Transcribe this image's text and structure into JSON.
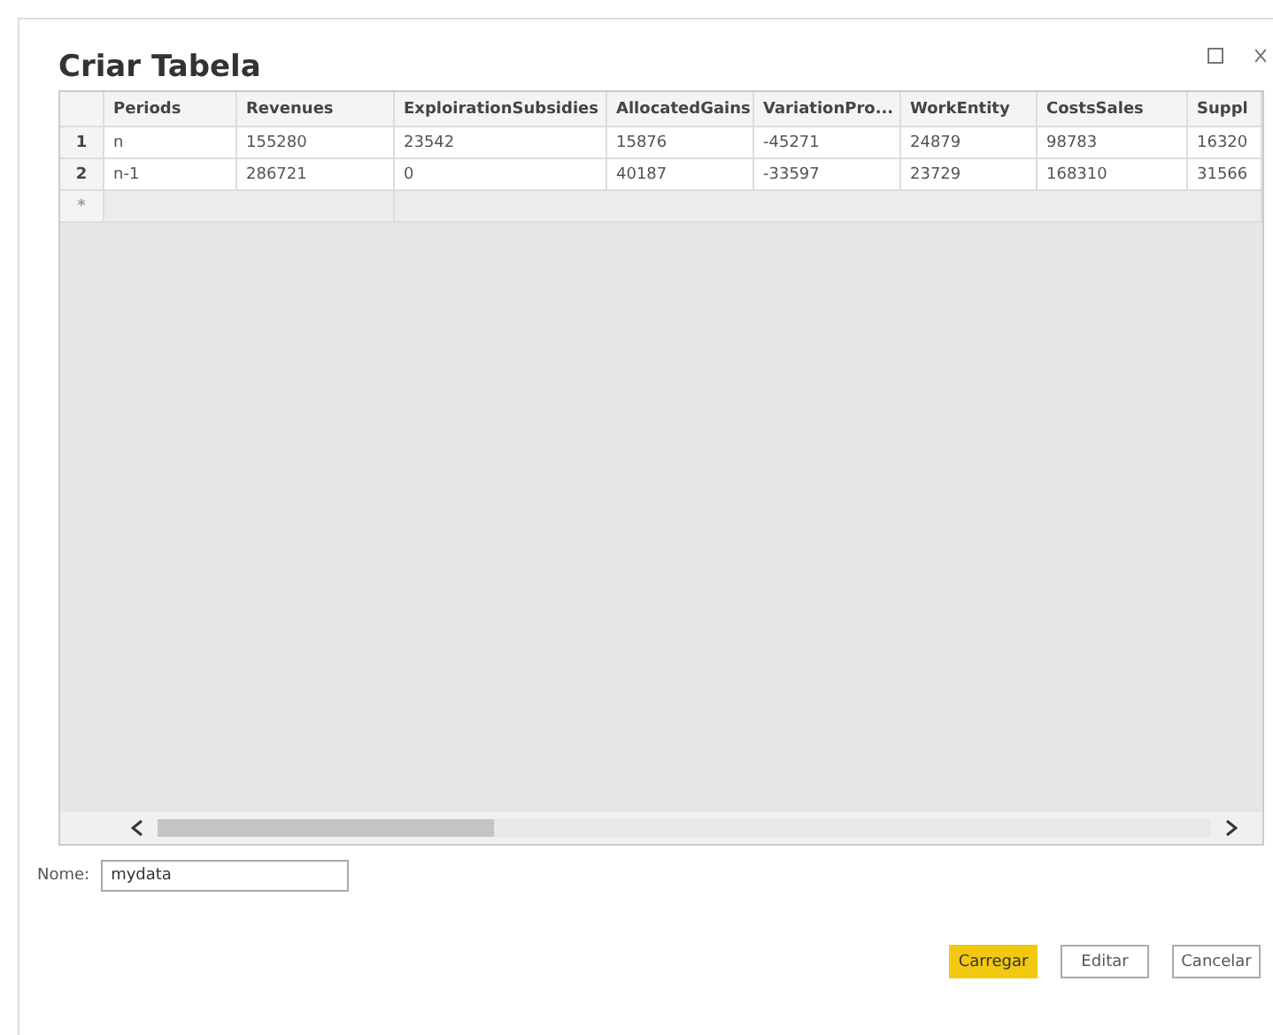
{
  "dialog": {
    "title": "Criar Tabela"
  },
  "table": {
    "columns": [
      "Periods",
      "Revenues",
      "ExploirationSubsidies",
      "AllocatedGains",
      "VariationPro...",
      "WorkEntity",
      "CostsSales",
      "Suppl"
    ],
    "rows": [
      {
        "number": "1",
        "cells": [
          "n",
          "155280",
          "23542",
          "15876",
          "-45271",
          "24879",
          "98783",
          "16320"
        ]
      },
      {
        "number": "2",
        "cells": [
          "n-1",
          "286721",
          "0",
          "40187",
          "-33597",
          "23729",
          "168310",
          "31566"
        ]
      }
    ],
    "new_row_marker": "*"
  },
  "name_field": {
    "label": "Nome:",
    "value": "mydata"
  },
  "buttons": [
    {
      "label": "Carregar",
      "primary": true
    },
    {
      "label": "Editar",
      "primary": false
    },
    {
      "label": "Cancelar",
      "primary": false
    }
  ]
}
